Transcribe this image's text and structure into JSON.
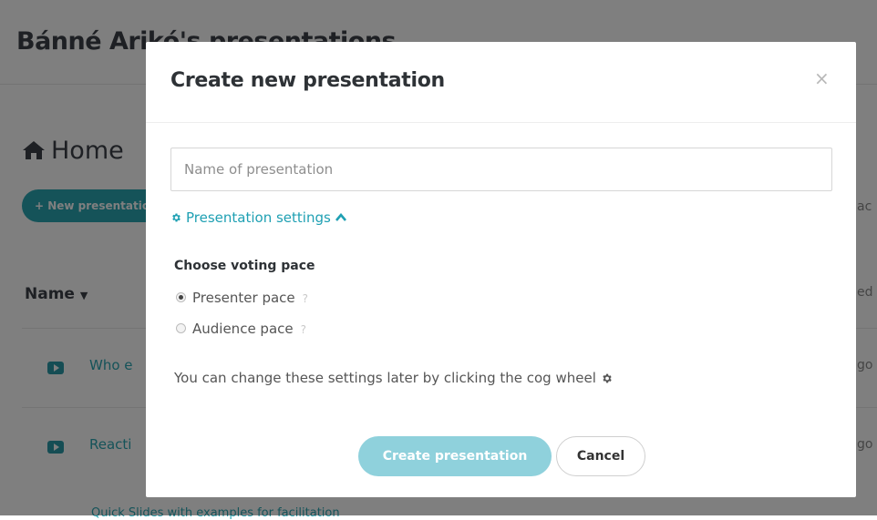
{
  "background": {
    "page_title": "Bánné Arikó's presentations",
    "home_label": "Home",
    "new_button_label": "+ New presentation",
    "name_column_label": "Name",
    "rows": [
      {
        "label": "Who e"
      },
      {
        "label": "Reacti"
      }
    ],
    "right_fragments": [
      "ac",
      "ed",
      "go",
      "go"
    ],
    "footer_fragment": "Quick Slides with examples for facilitation"
  },
  "modal": {
    "title": "Create new presentation",
    "close_glyph": "×",
    "name_placeholder": "Name of presentation",
    "name_value": "",
    "settings_link": "Presentation settings",
    "voting_pace_heading": "Choose voting pace",
    "pace_options": [
      {
        "label": "Presenter pace",
        "help": "?",
        "checked": true
      },
      {
        "label": "Audience pace",
        "help": "?",
        "checked": false
      }
    ],
    "hint_text": "You can change these settings later by clicking the cog wheel",
    "create_button": "Create presentation",
    "cancel_button": "Cancel"
  },
  "colors": {
    "accent": "#1fa0b3",
    "create_button_bg": "#8fd1dc",
    "overlay": "rgba(0,0,0,0.5)"
  },
  "icons": {
    "home": "home-icon",
    "close": "close-icon",
    "settings": "cog-icon",
    "chevron": "chevron-up-icon",
    "radio": "radio-icon",
    "help": "question-icon"
  }
}
